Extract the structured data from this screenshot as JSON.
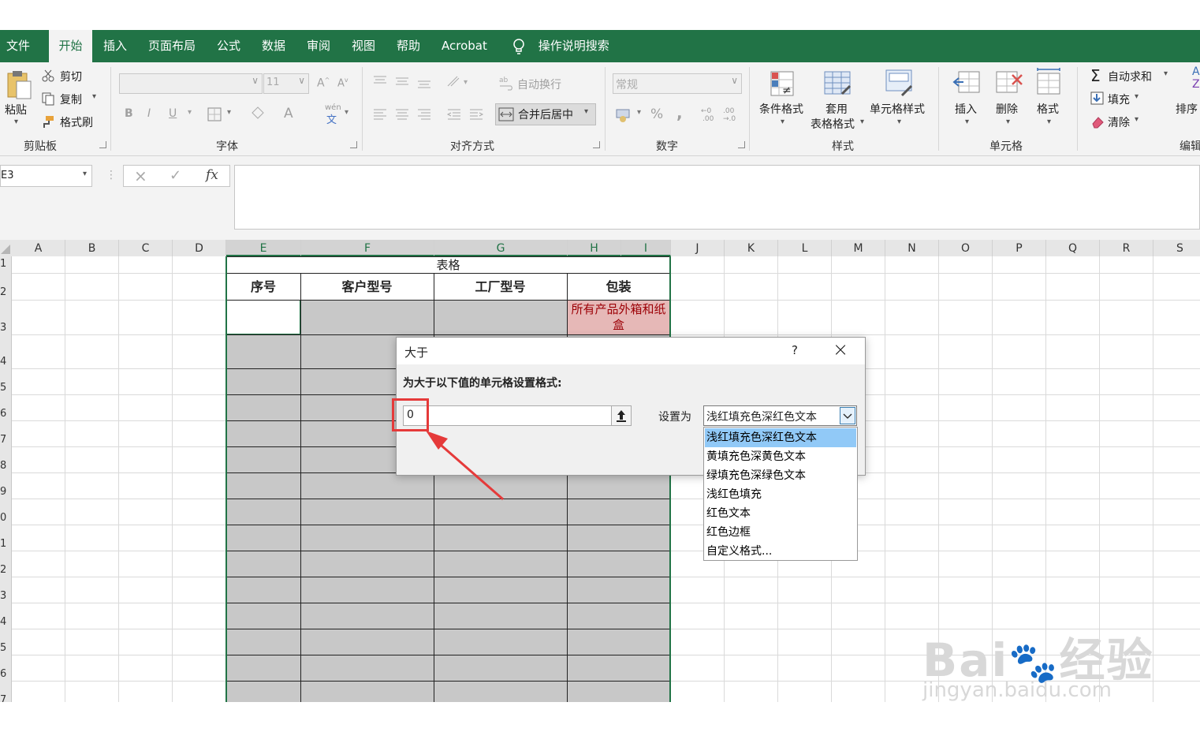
{
  "tabs": [
    {
      "label": "文件",
      "active": false
    },
    {
      "label": "开始",
      "active": true
    },
    {
      "label": "插入",
      "active": false
    },
    {
      "label": "页面布局",
      "active": false
    },
    {
      "label": "公式",
      "active": false
    },
    {
      "label": "数据",
      "active": false
    },
    {
      "label": "审阅",
      "active": false
    },
    {
      "label": "视图",
      "active": false
    },
    {
      "label": "帮助",
      "active": false
    },
    {
      "label": "Acrobat",
      "active": false
    }
  ],
  "tell_me": "操作说明搜索",
  "ribbon": {
    "clipboard": {
      "paste": "粘贴",
      "cut": "剪切",
      "copy": "复制",
      "format_painter": "格式刷",
      "group": "剪贴板"
    },
    "font": {
      "font_size": "11",
      "group": "字体",
      "bold": "B",
      "italic": "I",
      "underline": "U",
      "font_color": "A",
      "wen": "wén"
    },
    "alignment": {
      "wrap": "自动换行",
      "merge": "合并后居中",
      "group": "对齐方式"
    },
    "number": {
      "format": "常规",
      "percent": "%",
      "comma": ",",
      "group": "数字"
    },
    "styles": {
      "conditional": "条件格式",
      "table": "套用",
      "table2": "表格格式",
      "cell_styles": "单元格样式",
      "group": "样式"
    },
    "cells": {
      "insert": "插入",
      "delete": "删除",
      "format": "格式",
      "group": "单元格"
    },
    "editing": {
      "autosum": "自动求和",
      "fill": "填充",
      "clear": "清除",
      "sort": "排序",
      "group": "编辑"
    }
  },
  "name_box": "E3",
  "columns": [
    "A",
    "B",
    "C",
    "D",
    "E",
    "F",
    "G",
    "H",
    "I",
    "J",
    "K",
    "L",
    "M",
    "N",
    "O",
    "P",
    "Q",
    "R",
    "S"
  ],
  "rows": [
    "1",
    "2",
    "3",
    "4",
    "5",
    "6",
    "7",
    "8",
    "9",
    "0",
    "1",
    "2",
    "3",
    "4",
    "5",
    "6",
    "7"
  ],
  "table": {
    "title": "表格",
    "headers": [
      "序号",
      "客户型号",
      "工厂型号",
      "包装"
    ],
    "h3_note": "所有产品外箱和纸盒"
  },
  "dialog": {
    "title": "大于",
    "help": "?",
    "prompt": "为大于以下值的单元格设置格式:",
    "value": "0",
    "set_as": "设置为",
    "selected": "浅红填充色深红色文本",
    "options": [
      "浅红填充色深红色文本",
      "黄填充色深黄色文本",
      "绿填充色深绿色文本",
      "浅红色填充",
      "红色文本",
      "红色边框",
      "自定义格式..."
    ]
  },
  "colors": {
    "excel_green": "#217346",
    "gray_fill": "#c8c8c8",
    "pink_fill": "#e6b8b7",
    "dark_red": "#9c0006",
    "highlight": "#91c9f7",
    "annotation_red": "#e53a3a"
  }
}
